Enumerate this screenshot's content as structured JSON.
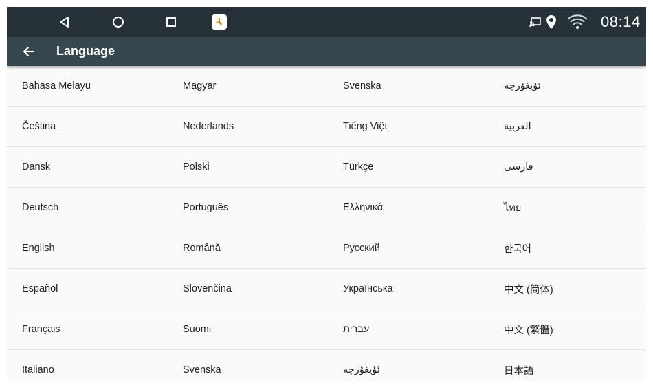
{
  "status_bar": {
    "time": "08:14",
    "icons": [
      "back-nav-icon",
      "home-nav-icon",
      "recents-nav-icon",
      "app-icon",
      "cast-icon",
      "location-icon",
      "wifi-icon"
    ]
  },
  "app_bar": {
    "title": "Language"
  },
  "languages": [
    [
      "Bahasa Melayu",
      "Magyar",
      "Svenska",
      "ئۇيغۇرچە"
    ],
    [
      "Čeština",
      "Nederlands",
      "Tiếng Việt",
      "العربية"
    ],
    [
      "Dansk",
      "Polski",
      "Türkçe",
      "فارسی"
    ],
    [
      "Deutsch",
      "Português",
      "Ελληνικά",
      "ไทย"
    ],
    [
      "English",
      "Română",
      "Русский",
      "한국어"
    ],
    [
      "Español",
      "Slovenčina",
      "Українська",
      "中文 (简体)"
    ],
    [
      "Français",
      "Suomi",
      "עברית",
      "中文 (繁體)"
    ],
    [
      "Italiano",
      "Svenska",
      "ئۇيغۇرچە",
      "日本語"
    ]
  ],
  "colors": {
    "status_bar_bg": "#263238",
    "app_bar_bg": "#37474f",
    "list_bg": "#fafafa",
    "divider": "#e3e3e3",
    "text": "#212121"
  }
}
